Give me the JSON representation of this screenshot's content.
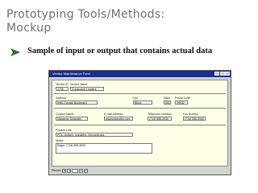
{
  "slide": {
    "title_line1": "Prototyping Tools/Methods:",
    "title_line2": "Mockup",
    "bullet": "Sample of input or output that contains actual data"
  },
  "form": {
    "window_title": "Vendor Maintenance Form",
    "vendor_id_label": "Vendor ID",
    "vendor_id": "2735",
    "vendor_name_label": "Vendor Name",
    "vendor_name": "Computing Leaders",
    "address_label": "Address",
    "address": "6961 Tyndall Boulevard",
    "city_label": "City",
    "city": "Biloxi",
    "state_label": "State",
    "state": "MS",
    "postal_code_label": "Postal Code",
    "postal_code": "39532",
    "contact_name_label": "Contact Name",
    "contact_name": "Marianne Schindler",
    "email_label": "E-mail Address",
    "email": "mschindler@cl.com",
    "telephone_label": "Telephone Number",
    "telephone": "(714) 555-3030",
    "fax_label": "Fax Number",
    "fax": "(714) 555-3940",
    "product_line_label": "Product Line",
    "product_line": "PCs, printers, speakers, microphones",
    "notes_label": "Notes",
    "notes": "Pager: (714) 555-3020",
    "record_label": "Record:"
  },
  "colors": {
    "title_gray": "#6f6f6f",
    "bullet_arrow": "#2f6b2f",
    "titlebar_blue": "#1a2f8a",
    "form_yellow": "#ffffe8"
  }
}
